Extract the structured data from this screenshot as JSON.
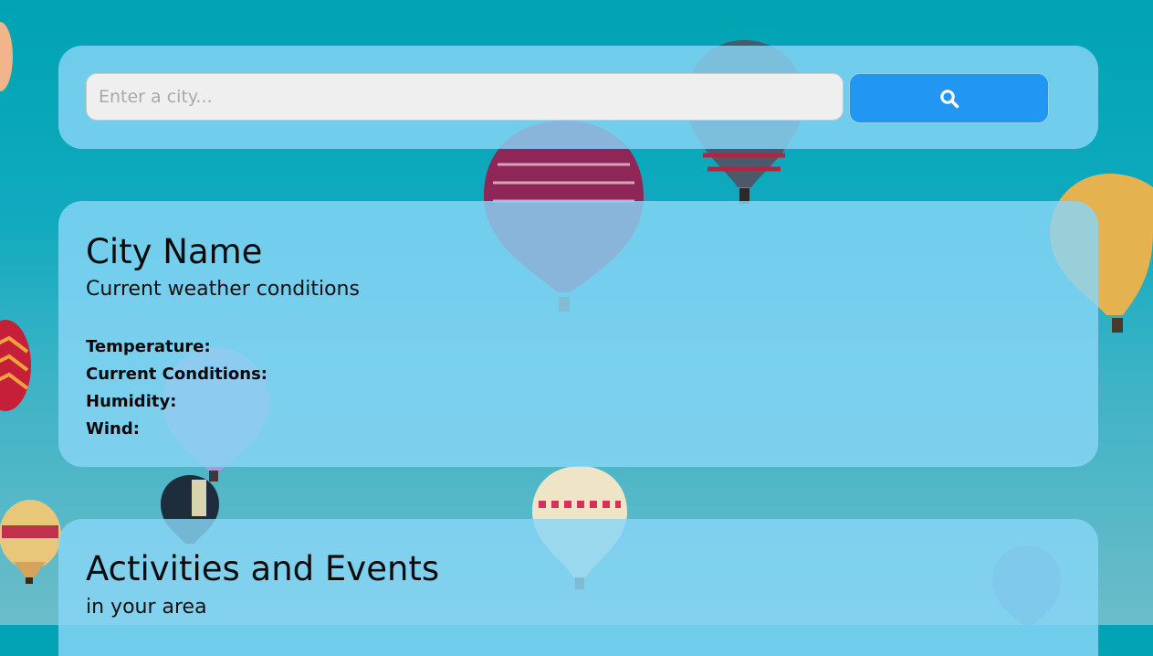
{
  "search": {
    "placeholder": "Enter a city...",
    "value": "",
    "button_icon": "search-icon"
  },
  "weather": {
    "title": "City Name",
    "subtitle": "Current weather conditions",
    "fields": [
      "Temperature:",
      "Current Conditions:",
      "Humidity:",
      "Wind:"
    ]
  },
  "events": {
    "title": "Activities and Events",
    "subtitle": "in your area"
  },
  "colors": {
    "sky": "#00a3b3",
    "panel": "#87d6f6",
    "button": "#2196f3",
    "input": "#efefef"
  }
}
